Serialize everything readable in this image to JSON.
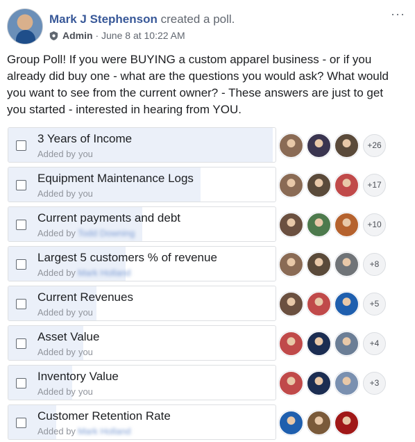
{
  "post": {
    "author": "Mark J Stephenson",
    "action": "created a poll.",
    "role": "Admin",
    "separator": " · ",
    "timestamp": "June 8 at 10:22 AM",
    "more": "···",
    "text": "Group Poll! If you were BUYING a custom apparel business - or if you already did buy one - what are the questions you would ask? What would you want to see from the current owner? - These answers are just to get you started - interested in hearing from YOU."
  },
  "poll": {
    "options": [
      {
        "label": "3 Years of Income",
        "added_prefix": "Added by",
        "added_by": "you",
        "blurred": false,
        "fill": 0.99,
        "extra": "+26",
        "voters": [
          "#8a6b55",
          "#3a3550",
          "#5a4a3a"
        ]
      },
      {
        "label": "Equipment Maintenance Logs",
        "added_prefix": "Added by",
        "added_by": "you",
        "blurred": false,
        "fill": 0.72,
        "extra": "+17",
        "voters": [
          "#8a6b55",
          "#5a4a3a",
          "#c04a4a"
        ]
      },
      {
        "label": "Current payments and debt",
        "added_prefix": "Added by",
        "added_by": "Todd Downing",
        "blurred": true,
        "fill": 0.5,
        "extra": "+10",
        "voters": [
          "#6b5040",
          "#4d7a4d",
          "#b5622e"
        ]
      },
      {
        "label": "Largest 5 customers % of revenue",
        "added_prefix": "Added by",
        "added_by": "Mark Holland",
        "blurred": true,
        "fill": 0.44,
        "extra": "+8",
        "voters": [
          "#8a6b55",
          "#5a4a3a",
          "#707478"
        ]
      },
      {
        "label": "Current Revenues",
        "added_prefix": "Added by",
        "added_by": "you",
        "blurred": false,
        "fill": 0.33,
        "extra": "+5",
        "voters": [
          "#6b5040",
          "#c04a4a",
          "#1f5fae"
        ]
      },
      {
        "label": "Asset Value",
        "added_prefix": "Added by",
        "added_by": "you",
        "blurred": false,
        "fill": 0.28,
        "extra": "+4",
        "voters": [
          "#c04a4a",
          "#1b2d52",
          "#6b7e96"
        ]
      },
      {
        "label": "Inventory Value",
        "added_prefix": "Added by",
        "added_by": "you",
        "blurred": false,
        "fill": 0.24,
        "extra": "+3",
        "voters": [
          "#c04a4a",
          "#1b2d52",
          "#7a90b0"
        ]
      },
      {
        "label": "Customer Retention Rate",
        "added_prefix": "Added by",
        "added_by": "Mark Holland",
        "blurred": true,
        "fill": 0.18,
        "extra": "",
        "voters": [
          "#1f5fae",
          "#7a5a3a",
          "#a01818"
        ]
      }
    ]
  },
  "colors": {
    "name_link": "#385898",
    "fill": "#ebf0f9",
    "border": "#dddfe2"
  }
}
